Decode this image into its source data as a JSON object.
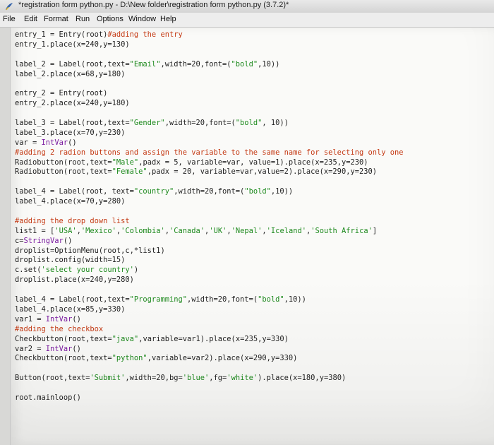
{
  "window": {
    "title": "*registration form python.py - D:\\New folder\\registration form python.py (3.7.2)*"
  },
  "menu": [
    "File",
    "Edit",
    "Format",
    "Run",
    "Options",
    "Window",
    "Help"
  ],
  "code_lines": [
    "entry_1 = Entry(root)#adding the entry",
    "entry_1.place(x=240,y=130)",
    "",
    "label_2 = Label(root,text=\"Email\",width=20,font=(\"bold\",10))",
    "label_2.place(x=68,y=180)",
    "",
    "entry_2 = Entry(root)",
    "entry_2.place(x=240,y=180)",
    "",
    "label_3 = Label(root,text=\"Gender\",width=20,font=(\"bold\", 10))",
    "label_3.place(x=70,y=230)",
    "var = IntVar()",
    "#adding 2 radion buttons and assign the variable to the same name for selecting only one",
    "Radiobutton(root,text=\"Male\",padx = 5, variable=var, value=1).place(x=235,y=230)",
    "Radiobutton(root,text=\"Female\",padx = 20, variable=var,value=2).place(x=290,y=230)",
    "",
    "label_4 = Label(root, text=\"country\",width=20,font=(\"bold\",10))",
    "label_4.place(x=70,y=280)",
    "",
    "#adding the drop down list",
    "list1 = ['USA','Mexico','Colombia','Canada','UK','Nepal','Iceland','South Africa']",
    "c=StringVar()",
    "droplist=OptionMenu(root,c,*list1)",
    "droplist.config(width=15)",
    "c.set('select your country')",
    "droplist.place(x=240,y=280)",
    "",
    "label_4 = Label(root,text=\"Programming\",width=20,font=(\"bold\",10))",
    "label_4.place(x=85,y=330)",
    "var1 = IntVar()",
    "#adding the checkbox",
    "Checkbutton(root,text=\"java\",variable=var1).place(x=235,y=330)",
    "var2 = IntVar()",
    "Checkbutton(root,text=\"python\",variable=var2).place(x=290,y=330)",
    "",
    "Button(root,text='Submit',width=20,bg='blue',fg='white').place(x=180,y=380)",
    "",
    "root.mainloop()"
  ],
  "colors": {
    "string": "#1e8a1e",
    "comment": "#c43a14",
    "builtin": "#7a1aa0",
    "default": "#1a1a1a"
  },
  "icons": {
    "app": "python-feather-icon"
  }
}
